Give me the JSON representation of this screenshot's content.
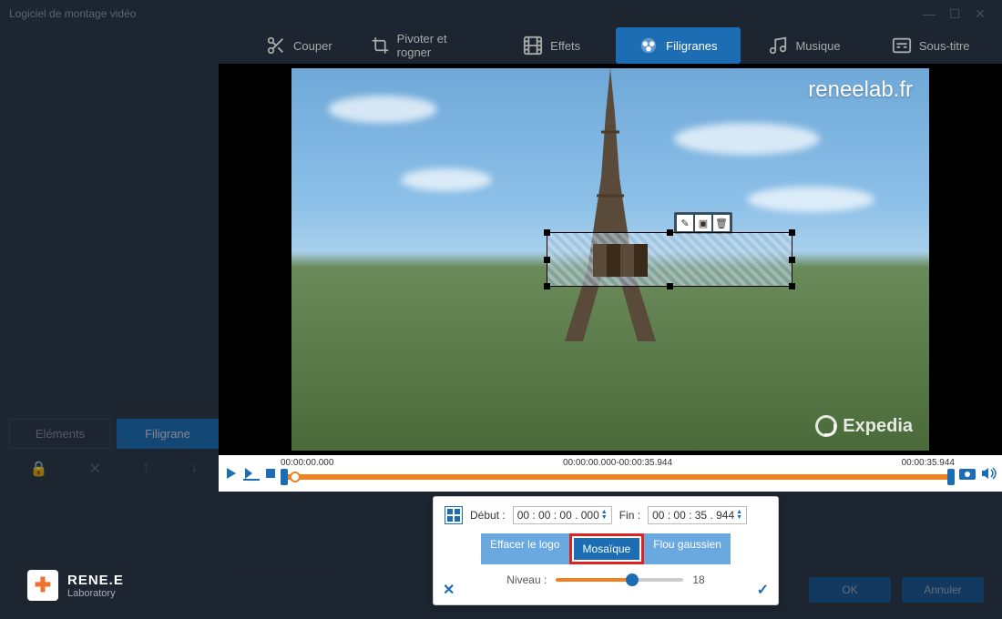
{
  "window": {
    "title": "Logiciel de montage vidéo"
  },
  "tabs": {
    "cut": "Couper",
    "rotate": "Pivoter et rogner",
    "effects": "Effets",
    "watermark": "Filigranes",
    "music": "Musique",
    "subtitle": "Sous-titre"
  },
  "left": {
    "elements": "Eléments",
    "watermark": "Filigrane"
  },
  "preview": {
    "watermark_top": "reneelab.fr",
    "watermark_bottom": "Expedia"
  },
  "timeline": {
    "start": "00:00:00.000",
    "range": "00:00:00.000-00:00:35.944",
    "end": "00:00:35.944"
  },
  "popup": {
    "debut_label": "Début :",
    "debut_value": "00 : 00 : 00 . 000",
    "fin_label": "Fin :",
    "fin_value": "00 : 00 : 35 . 944",
    "erase": "Effacer le logo",
    "mosaic": "Mosaïque",
    "gaussian": "Flou gaussien",
    "level_label": "Niveau :",
    "level_value": "18"
  },
  "dialog": {
    "ok": "OK",
    "cancel": "Annuler"
  },
  "brand": {
    "name": "RENE.E",
    "sub": "Laboratory"
  }
}
